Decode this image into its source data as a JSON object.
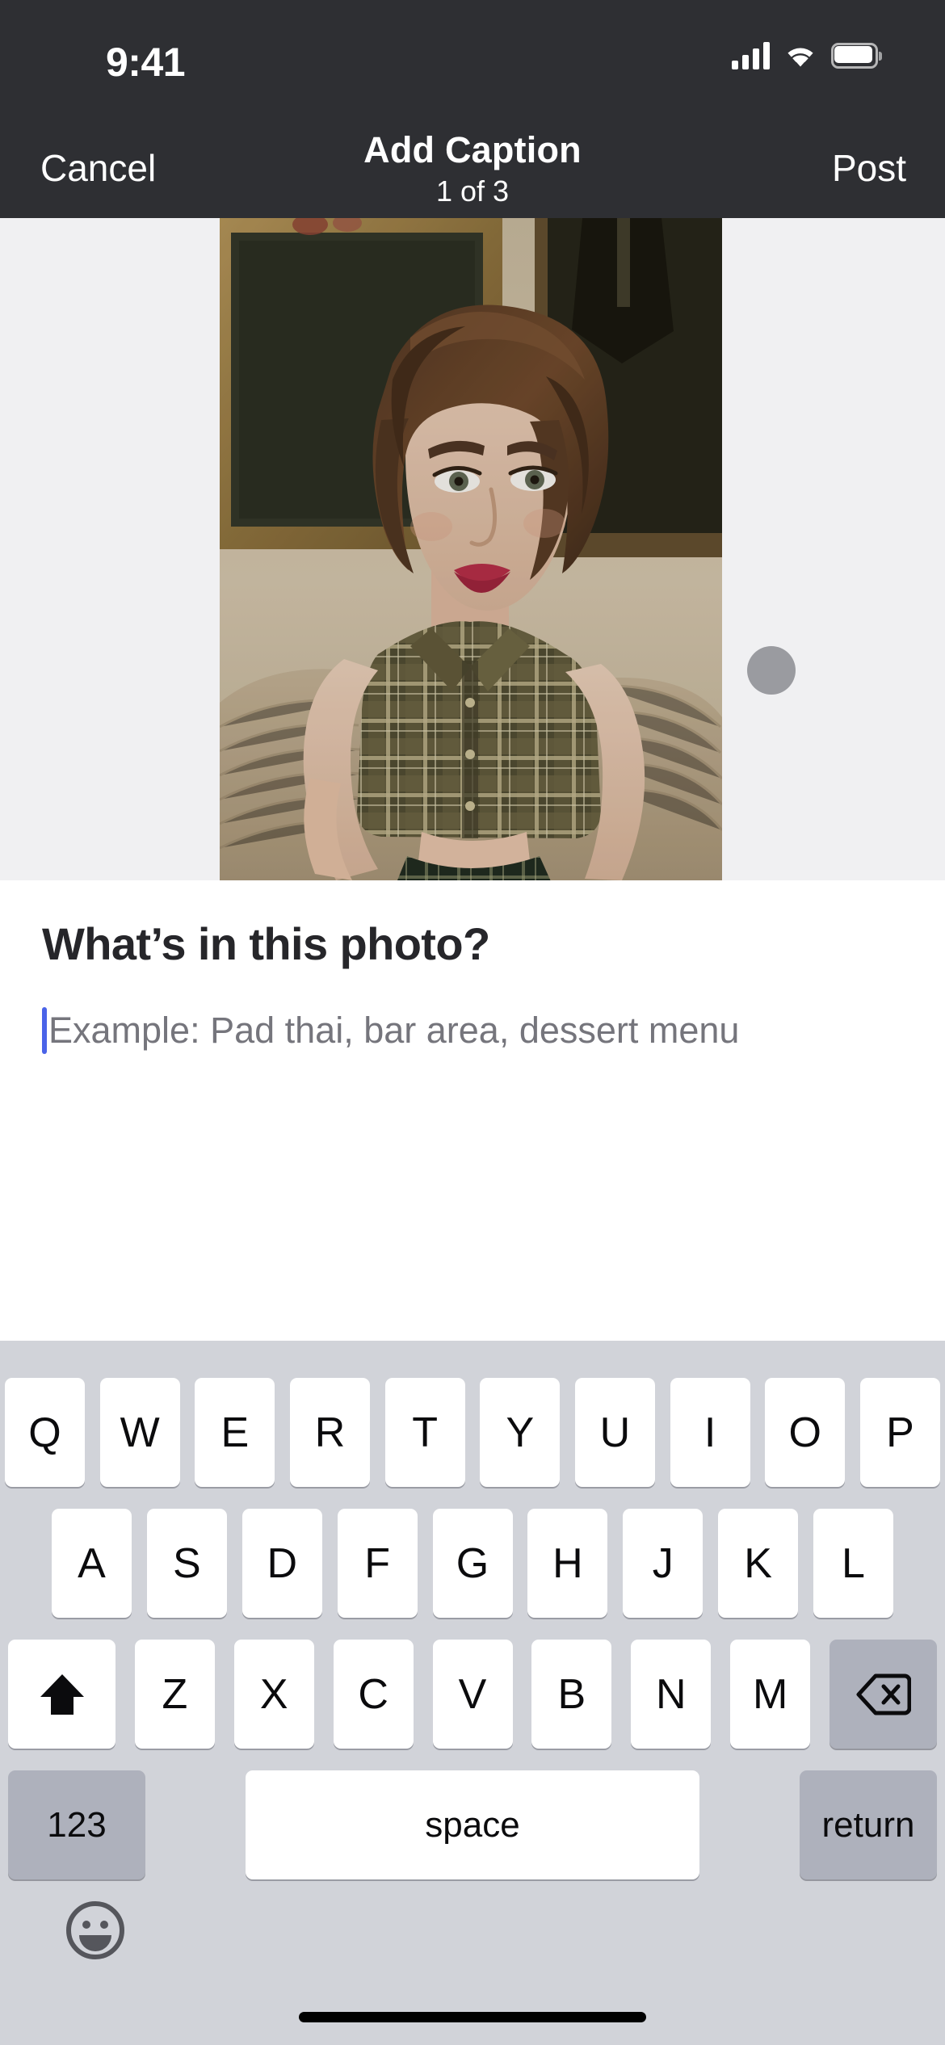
{
  "status_bar": {
    "time": "9:41",
    "icons": [
      "cellular-signal-icon",
      "wifi-icon",
      "battery-icon"
    ],
    "battery_level": 100,
    "signal_bars": 4,
    "background_color": "#2e2f33",
    "foreground_color": "#ffffff"
  },
  "nav_bar": {
    "cancel_label": "Cancel",
    "title": "Add Caption",
    "subtitle": "1 of 3",
    "post_label": "Post",
    "background_color": "#2e2f33"
  },
  "photo_strip": {
    "background_color": "#f0f0f2",
    "current_index": 1,
    "total": 3,
    "next_photo_dot_color": "#9a9ba0",
    "photo_alt": "woman-in-plaid-shirt-seated-on-sofa"
  },
  "caption": {
    "heading": "What’s in this photo?",
    "input_value": "",
    "placeholder": "Example: Pad thai, bar area, dessert menu",
    "caret_color": "#4a63e8",
    "placeholder_color": "#75757c"
  },
  "keyboard": {
    "background_color": "#d1d3d9",
    "key_color": "#ffffff",
    "modifier_key_color": "#aeb1bc",
    "row1": [
      "Q",
      "W",
      "E",
      "R",
      "T",
      "Y",
      "U",
      "I",
      "O",
      "P"
    ],
    "row2": [
      "A",
      "S",
      "D",
      "F",
      "G",
      "H",
      "J",
      "K",
      "L"
    ],
    "row3_letters": [
      "Z",
      "X",
      "C",
      "V",
      "B",
      "N",
      "M"
    ],
    "shift_icon": "shift-up-arrow-icon",
    "delete_icon": "backspace-delete-icon",
    "numbers_label": "123",
    "space_label": "space",
    "return_label": "return",
    "emoji_icon": "smiley-face-icon"
  },
  "home_indicator": {
    "color": "#000000"
  }
}
